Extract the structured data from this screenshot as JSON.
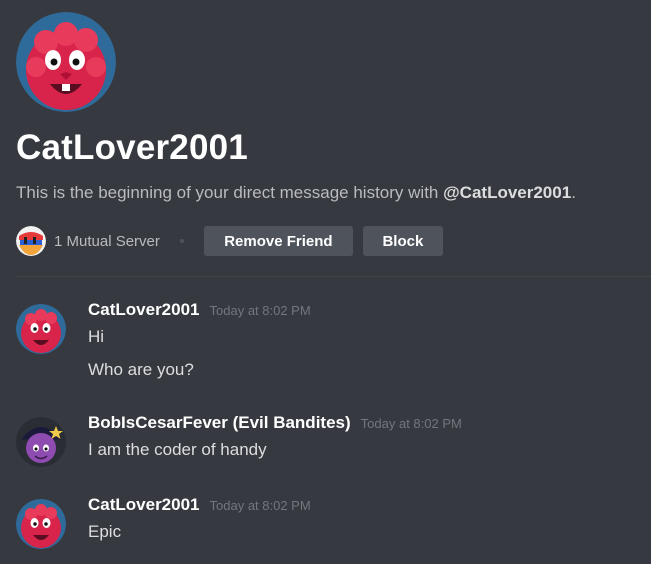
{
  "profile": {
    "username": "CatLover2001",
    "intro_prefix": "This is the beginning of your direct message history with ",
    "intro_mention": "@CatLover2001",
    "intro_suffix": ".",
    "avatar_icon": "flippy-cartoon-avatar"
  },
  "actions": {
    "mutual_servers": "1 Mutual Server",
    "remove_friend": "Remove Friend",
    "block": "Block"
  },
  "messages": [
    {
      "author": "CatLover2001",
      "timestamp": "Today at 8:02 PM",
      "lines": [
        "Hi",
        "Who are you?"
      ]
    },
    {
      "author": "BobIsCesarFever (Evil Bandites)",
      "timestamp": "Today at 8:02 PM",
      "lines": [
        "I am the coder of handy"
      ]
    },
    {
      "author": "CatLover2001",
      "timestamp": "Today at 8:02 PM",
      "lines": [
        "Epic"
      ]
    }
  ],
  "colors": {
    "background": "#36393f",
    "button": "#4f545c",
    "muted_text": "#b9bbbe",
    "timestamp": "#72767d"
  }
}
